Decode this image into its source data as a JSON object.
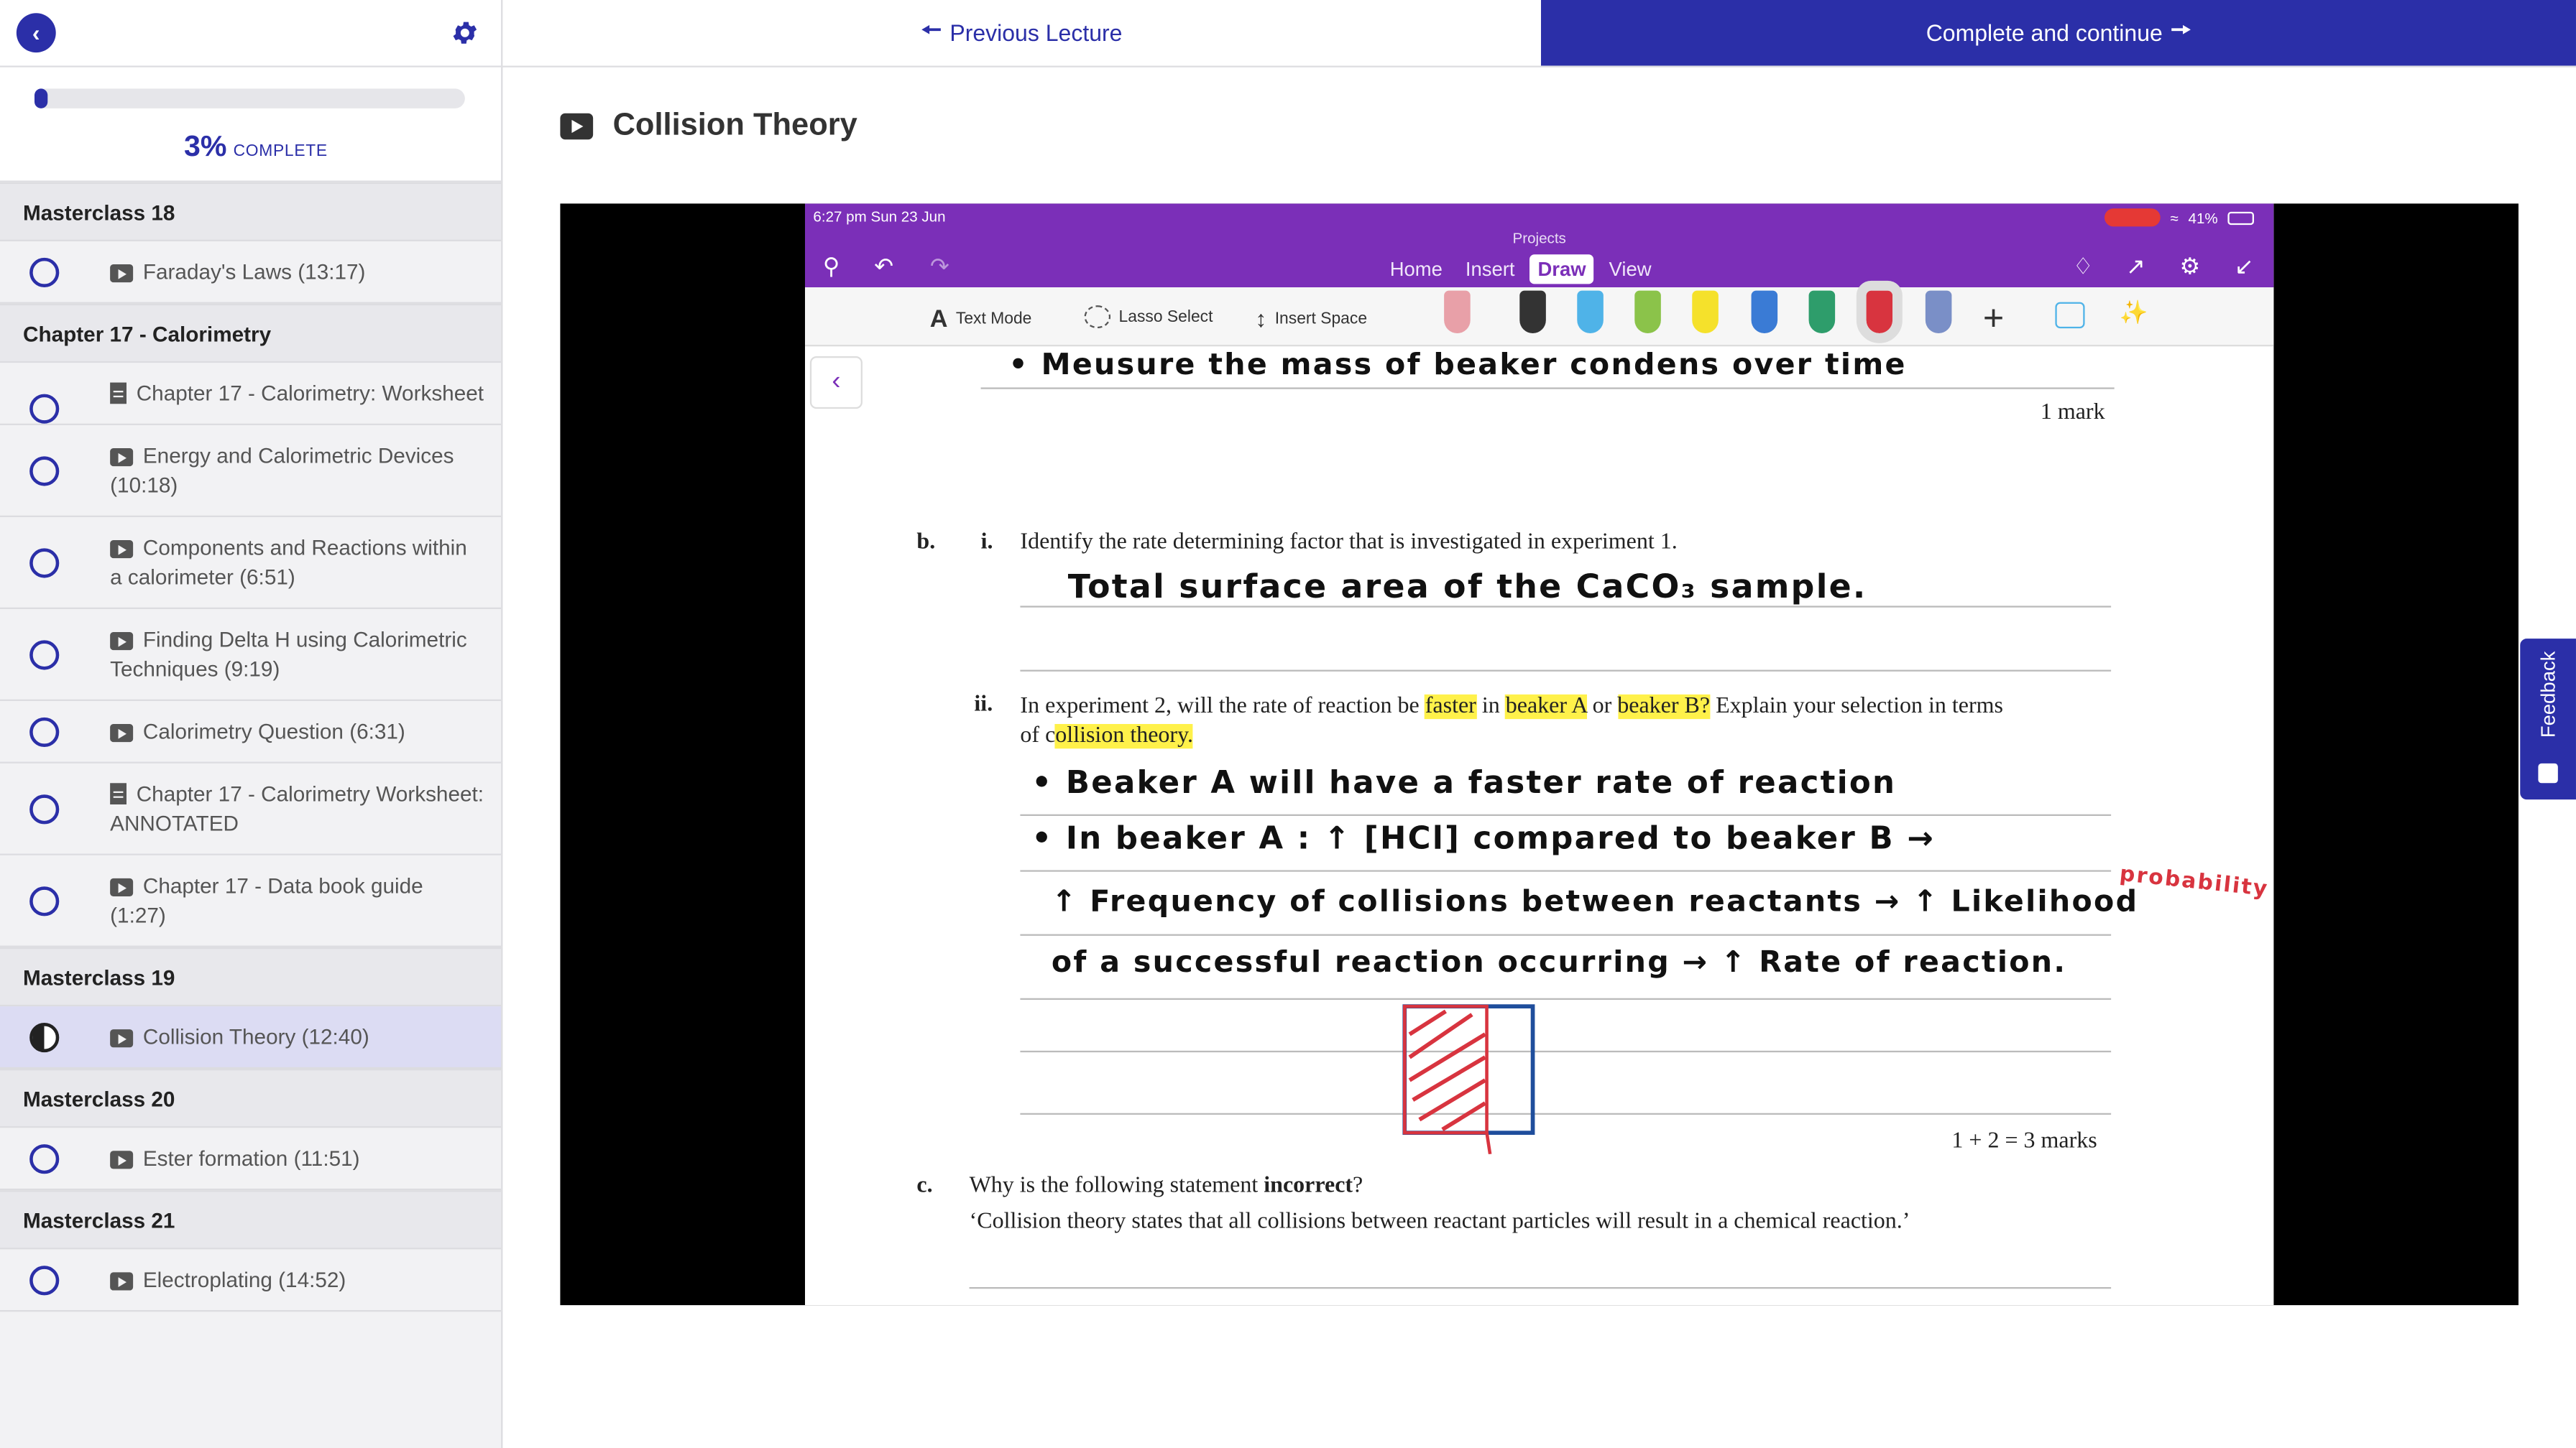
{
  "sidebar": {
    "progress": {
      "percent": 3,
      "percent_label": "3%",
      "complete_label": "COMPLETE"
    },
    "sections": [
      {
        "title": "Masterclass 18",
        "lessons": [
          {
            "label": "Faraday's Laws (13:17)",
            "type": "video",
            "status": "incomplete"
          }
        ]
      },
      {
        "title": "Chapter 17 - Calorimetry",
        "lessons": [
          {
            "label": "Chapter 17 - Calorimetry: Worksheet",
            "type": "document",
            "status": "incomplete"
          },
          {
            "label": "Energy and Calorimetric Devices (10:18)",
            "type": "video",
            "status": "incomplete"
          },
          {
            "label": "Components and Reactions within a calorimeter (6:51)",
            "type": "video",
            "status": "incomplete"
          },
          {
            "label": "Finding Delta H using Calorimetric Techniques (9:19)",
            "type": "video",
            "status": "incomplete"
          },
          {
            "label": "Calorimetry Question (6:31)",
            "type": "video",
            "status": "incomplete"
          },
          {
            "label": "Chapter 17 - Calorimetry Worksheet: ANNOTATED",
            "type": "document",
            "status": "incomplete"
          },
          {
            "label": "Chapter 17 - Data book guide (1:27)",
            "type": "video",
            "status": "incomplete"
          }
        ]
      },
      {
        "title": "Masterclass 19",
        "lessons": [
          {
            "label": "Collision Theory (12:40)",
            "type": "video",
            "status": "in-progress"
          }
        ]
      },
      {
        "title": "Masterclass 20",
        "lessons": [
          {
            "label": "Ester formation (11:51)",
            "type": "video",
            "status": "incomplete"
          }
        ]
      },
      {
        "title": "Masterclass 21",
        "lessons": [
          {
            "label": "Electroplating (14:52)",
            "type": "video",
            "status": "incomplete"
          }
        ]
      }
    ]
  },
  "nav": {
    "previous_label": "Previous Lecture",
    "next_label": "Complete and continue"
  },
  "lecture": {
    "title": "Collision Theory"
  },
  "video": {
    "status": {
      "time": "6:27 pm   Sun 23 Jun",
      "battery": "41%"
    },
    "app_title": "Projects",
    "menu": [
      "Home",
      "Insert",
      "Draw",
      "View"
    ],
    "menu_selected": "Draw",
    "toolbar": {
      "text_mode": "Text Mode",
      "lasso": "Lasso Select",
      "insert_space": "Insert Space"
    },
    "worksheet": {
      "hw_top": "•  Meusure  the  mass  of  beaker  condens  over  time",
      "mark_a": "1 mark",
      "b_label": "b.",
      "bi_label": "i.",
      "bi_question": "Identify the rate determining factor that is investigated in experiment 1.",
      "bi_answer": "Total  surface  area  of  the  CaCO₃  sample.",
      "bii_label": "ii.",
      "bii_q1": "In experiment 2, will the rate of reaction be ",
      "bii_hl1": "faster",
      "bii_q2": " in ",
      "bii_hl2": "beaker A",
      "bii_q3": " or ",
      "bii_hl3": "beaker B?",
      "bii_q4": " Explain your selection in terms",
      "bii_q5": "of c",
      "bii_hl4": "ollision theory.",
      "hw1": "•  Beaker  A  will  have  a  faster  rate  of  reaction",
      "hw2": "•  In  beaker  A :  ↑ [HCl]  compared  to  beaker  B  →",
      "hw3": "↑ Frequency  of  collisions  between  reactants  →  ↑ Likelihood",
      "hw4": "of  a  successful  reaction  occurring  →  ↑ Rate  of  reaction.",
      "hw_red": "probability",
      "marks_b": "1 + 2 = 3 marks",
      "c_label": "c.",
      "c_q1": "Why is the following statement ",
      "c_q1_bold": "incorrect",
      "c_q1_end": "?",
      "c_q2": "‘Collision theory states that all collisions between reactant particles will result in a chemical reaction.’"
    }
  },
  "feedback": {
    "label": "Feedback"
  },
  "colors": {
    "brand": "#2b2fa8",
    "onenote_purple": "#7b2fb8",
    "highlight": "#fff14a"
  }
}
